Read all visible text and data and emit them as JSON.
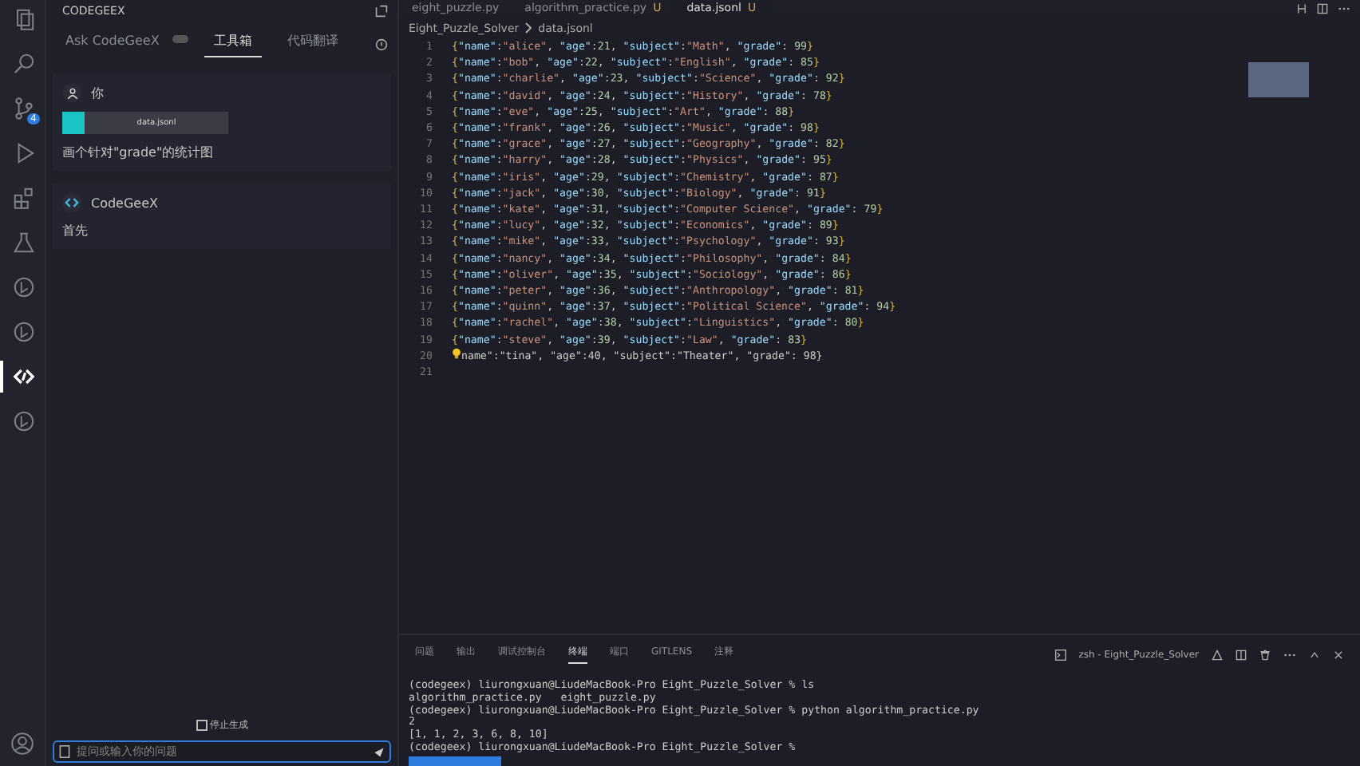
{
  "activity_bar": {
    "items": [
      {
        "kind": "files",
        "selected": false
      },
      {
        "kind": "search",
        "selected": false
      },
      {
        "kind": "branch",
        "selected": false,
        "badge": "4"
      },
      {
        "kind": "run",
        "selected": false
      },
      {
        "kind": "blocks",
        "selected": false
      },
      {
        "kind": "flask",
        "selected": false
      },
      {
        "kind": "circle",
        "selected": false
      },
      {
        "kind": "circle",
        "selected": false
      },
      {
        "kind": "codegeex",
        "selected": true
      },
      {
        "kind": "circle",
        "selected": false
      }
    ]
  },
  "sidebar": {
    "title": "CODEGEEX",
    "tabs": [
      {
        "label": "Ask CodeGeeX",
        "selected": false
      },
      {
        "label": "工具箱",
        "selected": true
      },
      {
        "label": "代码翻译",
        "selected": false
      }
    ],
    "messages": [
      {
        "kind": "user",
        "author": "你",
        "attachment": "data.jsonl",
        "text": "画个针对\"grade\"的统计图"
      },
      {
        "kind": "bot",
        "author": "CodeGeeX",
        "text": "首先"
      }
    ],
    "stop_button": "停止生成",
    "input": {
      "placeholder": "提问或输入你的问题"
    }
  },
  "editor": {
    "tabs": [
      {
        "label": "eight_puzzle.py",
        "selected": false
      },
      {
        "label": "algorithm_practice.py",
        "selected": false,
        "modified": "U"
      },
      {
        "label": "data.jsonl",
        "selected": true,
        "modified": "U"
      }
    ],
    "breadcrumb": [
      "Eight_Puzzle_Solver",
      "data.jsonl"
    ],
    "lines": [
      {
        "number": "1",
        "text": "{\"name\":\"alice\", \"age\":21, \"subject\":\"Math\", \"grade\": 99}",
        "lightbulb": false
      },
      {
        "number": "2",
        "text": "{\"name\":\"bob\", \"age\":22, \"subject\":\"English\", \"grade\": 85}",
        "lightbulb": false
      },
      {
        "number": "3",
        "text": "{\"name\":\"charlie\", \"age\":23, \"subject\":\"Science\", \"grade\": 92}",
        "lightbulb": false
      },
      {
        "number": "4",
        "text": "{\"name\":\"david\", \"age\":24, \"subject\":\"History\", \"grade\": 78}",
        "lightbulb": false
      },
      {
        "number": "5",
        "text": "{\"name\":\"eve\", \"age\":25, \"subject\":\"Art\", \"grade\": 88}",
        "lightbulb": false
      },
      {
        "number": "6",
        "text": "{\"name\":\"frank\", \"age\":26, \"subject\":\"Music\", \"grade\": 98}",
        "lightbulb": false
      },
      {
        "number": "7",
        "text": "{\"name\":\"grace\", \"age\":27, \"subject\":\"Geography\", \"grade\": 82}",
        "lightbulb": false
      },
      {
        "number": "8",
        "text": "{\"name\":\"harry\", \"age\":28, \"subject\":\"Physics\", \"grade\": 95}",
        "lightbulb": false
      },
      {
        "number": "9",
        "text": "{\"name\":\"iris\", \"age\":29, \"subject\":\"Chemistry\", \"grade\": 87}",
        "lightbulb": false
      },
      {
        "number": "10",
        "text": "{\"name\":\"jack\", \"age\":30, \"subject\":\"Biology\", \"grade\": 91}",
        "lightbulb": false
      },
      {
        "number": "11",
        "text": "{\"name\":\"kate\", \"age\":31, \"subject\":\"Computer Science\", \"grade\": 79}",
        "lightbulb": false
      },
      {
        "number": "12",
        "text": "{\"name\":\"lucy\", \"age\":32, \"subject\":\"Economics\", \"grade\": 89}",
        "lightbulb": false
      },
      {
        "number": "13",
        "text": "{\"name\":\"mike\", \"age\":33, \"subject\":\"Psychology\", \"grade\": 93}",
        "lightbulb": false
      },
      {
        "number": "14",
        "text": "{\"name\":\"nancy\", \"age\":34, \"subject\":\"Philosophy\", \"grade\": 84}",
        "lightbulb": false
      },
      {
        "number": "15",
        "text": "{\"name\":\"oliver\", \"age\":35, \"subject\":\"Sociology\", \"grade\": 86}",
        "lightbulb": false
      },
      {
        "number": "16",
        "text": "{\"name\":\"peter\", \"age\":36, \"subject\":\"Anthropology\", \"grade\": 81}",
        "lightbulb": false
      },
      {
        "number": "17",
        "text": "{\"name\":\"quinn\", \"age\":37, \"subject\":\"Political Science\", \"grade\": 94}",
        "lightbulb": false
      },
      {
        "number": "18",
        "text": "{\"name\":\"rachel\", \"age\":38, \"subject\":\"Linguistics\", \"grade\": 80}",
        "lightbulb": false
      },
      {
        "number": "19",
        "text": "{\"name\":\"steve\", \"age\":39, \"subject\":\"Law\", \"grade\": 83}",
        "lightbulb": false
      },
      {
        "number": "20",
        "text": "name\":\"tina\", \"age\":40, \"subject\":\"Theater\", \"grade\": 98}",
        "lightbulb": true
      },
      {
        "number": "21",
        "lightbulb": false
      }
    ]
  },
  "panel": {
    "tabs": [
      {
        "label": "问题",
        "selected": false
      },
      {
        "label": "输出",
        "selected": false
      },
      {
        "label": "调试控制台",
        "selected": false
      },
      {
        "label": "终端",
        "selected": true
      },
      {
        "label": "端口",
        "selected": false
      },
      {
        "label": "GITLENS",
        "selected": false
      },
      {
        "label": "注释",
        "selected": false
      }
    ],
    "terminal_name": "zsh - Eight_Puzzle_Solver",
    "terminal_lines": [
      "(codegeex) liurongxuan@LiudeMacBook-Pro Eight_Puzzle_Solver % ls",
      "algorithm_practice.py   eight_puzzle.py",
      "(codegeex) liurongxuan@LiudeMacBook-Pro Eight_Puzzle_Solver % python algorithm_practice.py",
      "2",
      "[1, 1, 2, 3, 6, 8, 10]",
      "(codegeex) liurongxuan@LiudeMacBook-Pro Eight_Puzzle_Solver %"
    ]
  }
}
